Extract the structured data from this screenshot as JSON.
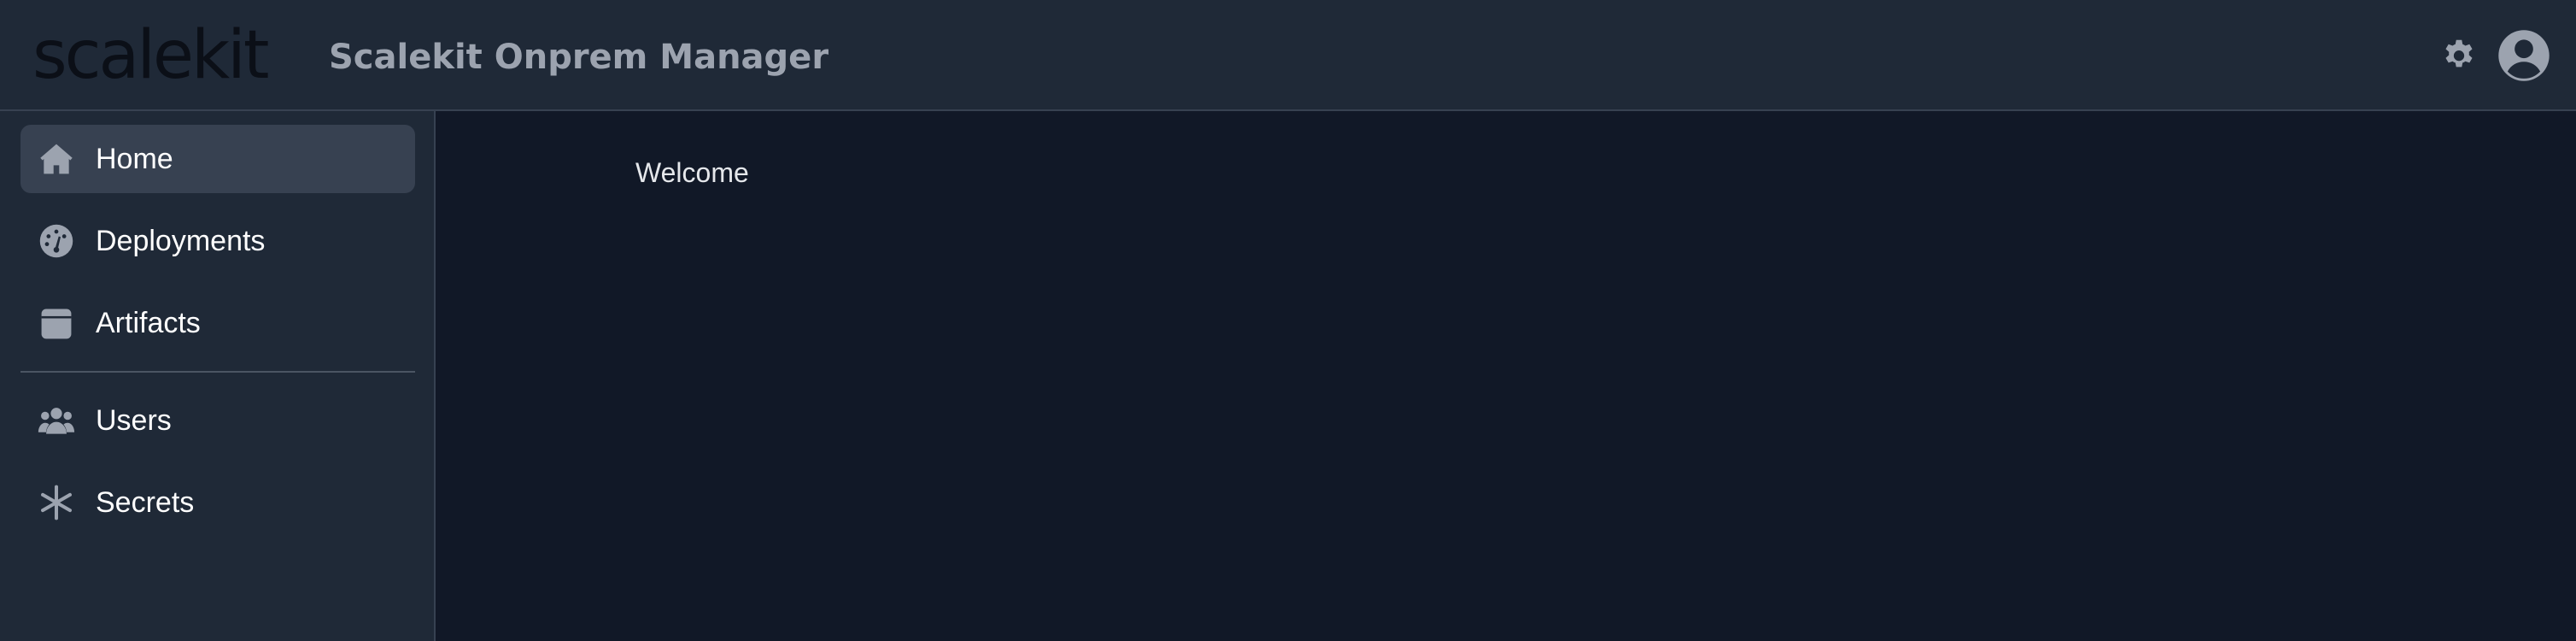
{
  "header": {
    "logo_text": "scalekit",
    "title": "Scalekit Onprem Manager",
    "settings_icon": "gear-icon",
    "profile_icon": "user-circle-icon"
  },
  "sidebar": {
    "items": [
      {
        "label": "Home",
        "icon": "home-icon",
        "active": true
      },
      {
        "label": "Deployments",
        "icon": "gauge-icon",
        "active": false
      },
      {
        "label": "Artifacts",
        "icon": "archive-box-icon",
        "active": false
      },
      {
        "label": "Users",
        "icon": "users-icon",
        "active": false
      },
      {
        "label": "Secrets",
        "icon": "asterisk-icon",
        "active": false
      }
    ]
  },
  "main": {
    "welcome_text": "Welcome"
  },
  "colors": {
    "header_bg": "#1f2937",
    "sidebar_bg": "#1f2937",
    "main_bg": "#111827",
    "active_item_bg": "#374151",
    "icon": "#9ca3af",
    "title": "#9ca3af"
  }
}
